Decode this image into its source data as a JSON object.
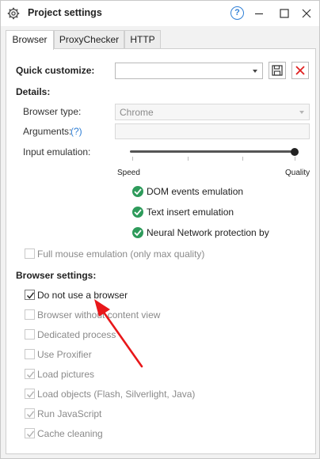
{
  "window": {
    "title": "Project settings",
    "icon": "gear-icon",
    "help_label": "?",
    "controls": [
      "minimize-icon",
      "maximize-icon",
      "close-icon"
    ]
  },
  "tabs": [
    {
      "label": "Browser",
      "active": true
    },
    {
      "label": "ProxyChecker",
      "active": false
    },
    {
      "label": "HTTP",
      "active": false
    }
  ],
  "quick_customize": {
    "label": "Quick customize:",
    "value": "",
    "save_icon": "save-icon",
    "clear_icon": "clear-icon"
  },
  "details": {
    "heading": "Details:",
    "browser_type_label": "Browser type:",
    "browser_type_value": "Chrome",
    "arguments_label": "Arguments:",
    "arguments_help": "(?)",
    "arguments_value": "",
    "input_emulation_label": "Input emulation:",
    "slider_min_label": "Speed",
    "slider_max_label": "Quality",
    "slider_level": 1.0,
    "emulations": [
      {
        "label": "DOM events emulation",
        "checked": true
      },
      {
        "label": "Text insert emulation",
        "checked": true
      },
      {
        "label": "Neural Network protection bypas",
        "checked": true
      }
    ],
    "full_mouse_label": "Full mouse emulation (only max quality)",
    "full_mouse_checked": false
  },
  "browser_settings": {
    "heading": "Browser settings:",
    "options": [
      {
        "label": "Do not use a browser",
        "checked": true,
        "enabled": true
      },
      {
        "label": "Browser without content view",
        "checked": false,
        "enabled": false
      },
      {
        "label": "Dedicated process",
        "checked": false,
        "enabled": false
      },
      {
        "label": "Use Proxifier",
        "checked": false,
        "enabled": false
      },
      {
        "label": "Load pictures",
        "checked": true,
        "enabled": false
      },
      {
        "label": "Load objects (Flash, Silverlight, Java)",
        "checked": true,
        "enabled": false
      },
      {
        "label": "Run JavaScript",
        "checked": true,
        "enabled": false
      },
      {
        "label": "Cache cleaning",
        "checked": true,
        "enabled": false
      }
    ]
  },
  "colors": {
    "accent_blue": "#2f7fd6",
    "check_green": "#2e9b5b",
    "clear_red": "#e02020",
    "annotation_red": "#e8171a"
  }
}
